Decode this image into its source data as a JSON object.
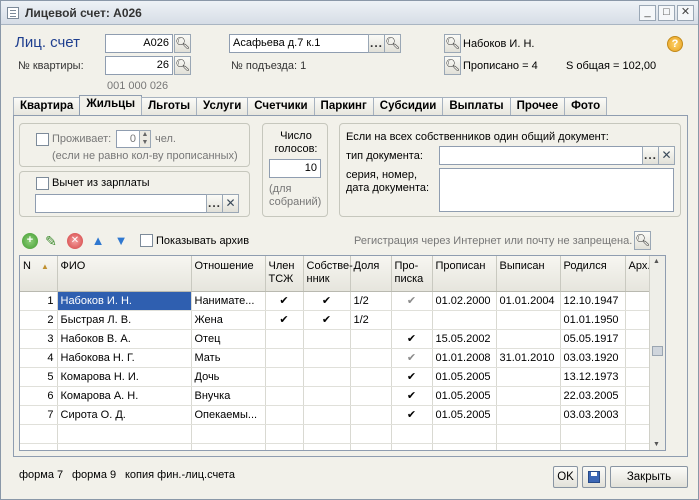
{
  "window": {
    "title": "Лицевой счет: А026"
  },
  "header": {
    "account_label": "Лиц. счет",
    "account_value": "А026",
    "apartment_label": "№ квартиры:",
    "apartment_value": "26",
    "account_number": "001 000 026",
    "address_value": "Асафьева д.7 к.1",
    "entrance_label": "№ подъезда:",
    "entrance_value": "1",
    "owner_name": "Набоков И. Н.",
    "registered_text": "Прописано = 4",
    "area_text": "S общая = 102,00"
  },
  "tabs": [
    "Квартира",
    "Жильцы",
    "Льготы",
    "Услуги",
    "Счетчики",
    "Паркинг",
    "Субсидии",
    "Выплаты",
    "Прочее",
    "Фото"
  ],
  "active_tab": "Жильцы",
  "lives": {
    "label": "Проживает:",
    "value": "0",
    "unit": "чел.",
    "hint": "(если не равно кол-ву прописанных)"
  },
  "salary": {
    "label": "Вычет из зарплаты"
  },
  "votes": {
    "label": "Число голосов:",
    "value": "10",
    "hint": "(для собраний)"
  },
  "doc": {
    "title": "Если на всех собственников один общий документ:",
    "type_label": "тип документа:",
    "series_label": "серия, номер, дата документа:"
  },
  "toolbar": {
    "show_archive": "Показывать архив",
    "reg_note": "Регистрация через Интернет или почту не запрещена."
  },
  "table": {
    "columns": [
      "N",
      "ФИО",
      "Отношение",
      "Член ТСЖ",
      "Собстве-нник",
      "Доля",
      "Про-писка",
      "Прописан",
      "Выписан",
      "Родился",
      "Арх..."
    ],
    "rows": [
      {
        "n": "1",
        "fio": "Набоков И. Н.",
        "rel": "Нанимате...",
        "member": "✔",
        "owner": "✔",
        "share": "1/2",
        "reg": "✔",
        "in": "01.02.2000",
        "out": "01.01.2004",
        "born": "12.10.1947"
      },
      {
        "n": "2",
        "fio": "Быстрая Л. В.",
        "rel": "Жена",
        "member": "✔",
        "owner": "✔",
        "share": "1/2",
        "reg": "",
        "in": "",
        "out": "",
        "born": "01.01.1950"
      },
      {
        "n": "3",
        "fio": "Набоков В. А.",
        "rel": "Отец",
        "member": "",
        "owner": "",
        "share": "",
        "reg": "✔",
        "in": "15.05.2002",
        "out": "",
        "born": "05.05.1917"
      },
      {
        "n": "4",
        "fio": "Набокова Н. Г.",
        "rel": "Мать",
        "member": "",
        "owner": "",
        "share": "",
        "reg": "✔",
        "in": "01.01.2008",
        "out": "31.01.2010",
        "born": "03.03.1920"
      },
      {
        "n": "5",
        "fio": "Комарова Н. И.",
        "rel": "Дочь",
        "member": "",
        "owner": "",
        "share": "",
        "reg": "✔",
        "in": "01.05.2005",
        "out": "",
        "born": "13.12.1973"
      },
      {
        "n": "6",
        "fio": "Комарова А. Н.",
        "rel": "Внучка",
        "member": "",
        "owner": "",
        "share": "",
        "reg": "✔",
        "in": "01.05.2005",
        "out": "",
        "born": "22.03.2005"
      },
      {
        "n": "7",
        "fio": "Сирота О. Д.",
        "rel": "Опекаемы...",
        "member": "",
        "owner": "",
        "share": "",
        "reg": "✔",
        "in": "01.05.2005",
        "out": "",
        "born": "03.03.2003"
      }
    ]
  },
  "footer": {
    "form7": "форма 7",
    "form9": "форма 9",
    "copy": "копия фин.-лиц.счета",
    "ok": "OK",
    "close": "Закрыть"
  },
  "colors": {
    "title_blue": "#1f3f8f",
    "selection": "#2f5fb0",
    "panel_bg": "#f2f1ea"
  }
}
